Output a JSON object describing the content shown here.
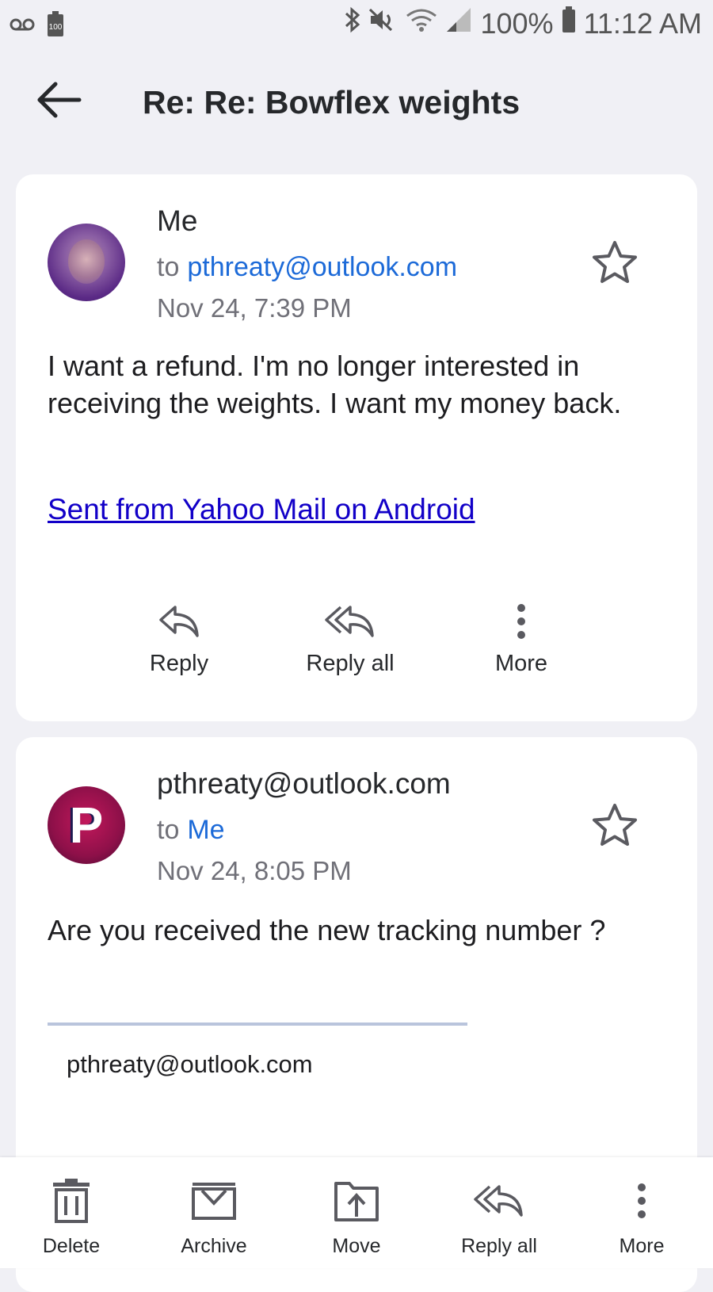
{
  "status_bar": {
    "battery_percent": "100%",
    "time": "11:12 AM",
    "left_icons": [
      "voicemail-icon",
      "battery-saver-icon"
    ],
    "right_icons": [
      "bluetooth-icon",
      "muted-icon",
      "wifi-icon",
      "signal-icon",
      "battery-icon"
    ]
  },
  "header": {
    "subject": "Re: Re: Bowflex weights"
  },
  "messages": [
    {
      "sender": "Me",
      "to_label": "to",
      "recipient": "pthreaty@outlook.com",
      "date": "Nov 24, 7:39 PM",
      "body": "I want a refund. I'm no longer interested in receiving the weights. I want my money back.",
      "signature_link": "Sent from Yahoo Mail on Android",
      "actions": {
        "reply": "Reply",
        "reply_all": "Reply all",
        "more": "More"
      }
    },
    {
      "sender": "pthreaty@outlook.com",
      "avatar_letter": "P",
      "to_label": "to",
      "recipient": "Me",
      "date": "Nov 24, 8:05 PM",
      "body": "Are you received the new tracking number ?",
      "quoted_address": "pthreaty@outlook.com"
    }
  ],
  "toolbar": {
    "delete": "Delete",
    "archive": "Archive",
    "move": "Move",
    "reply_all": "Reply all",
    "more": "More"
  },
  "colors": {
    "background": "#f0f0f5",
    "link_blue": "#1c6ad8",
    "signature_link": "#1200c8",
    "icon_gray": "#5a5a60"
  }
}
